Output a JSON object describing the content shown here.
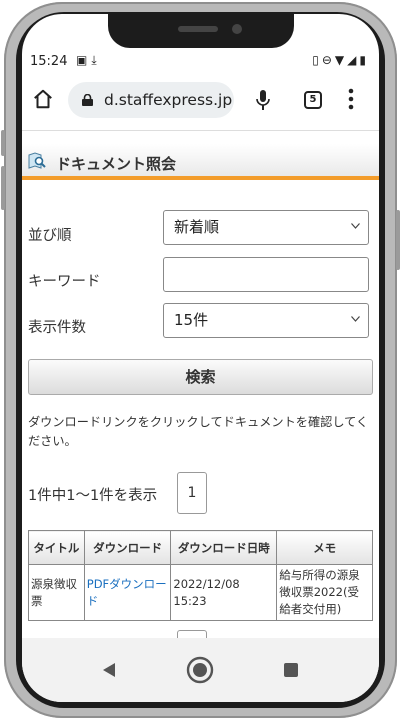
{
  "status_bar": {
    "time": "15:24",
    "left_icons": [
      "image-icon",
      "download-done-icon"
    ],
    "right_icons": [
      "vibrate-icon",
      "dnd-icon",
      "data-icon",
      "wifi-icon",
      "signal-icon",
      "battery-icon"
    ]
  },
  "browser": {
    "url": "d.staffexpress.jp",
    "tab_count": "5"
  },
  "page": {
    "title": "ドキュメント照会",
    "sort": {
      "label": "並び順",
      "value": "新着順"
    },
    "keyword": {
      "label": "キーワード",
      "value": "",
      "placeholder": ""
    },
    "per_page": {
      "label": "表示件数",
      "value": "15件"
    },
    "search_label": "検索",
    "note": "ダウンロードリンクをクリックしてドキュメントを確認してください。",
    "result_count": "1件中1〜1件を表示",
    "page_number": "1",
    "table": {
      "headers": [
        "タイトル",
        "ダウンロード",
        "ダウンロード日時",
        "メモ"
      ],
      "rows": [
        {
          "title": "源泉徴収票",
          "download": "PDFダウンロード",
          "downloaded_at": "2022/12/08 15:23",
          "memo": "給与所得の源泉徴収票2022(受給者交付用)"
        }
      ]
    }
  },
  "colors": {
    "accent": "#f39c2a",
    "link": "#1a6fbf"
  }
}
